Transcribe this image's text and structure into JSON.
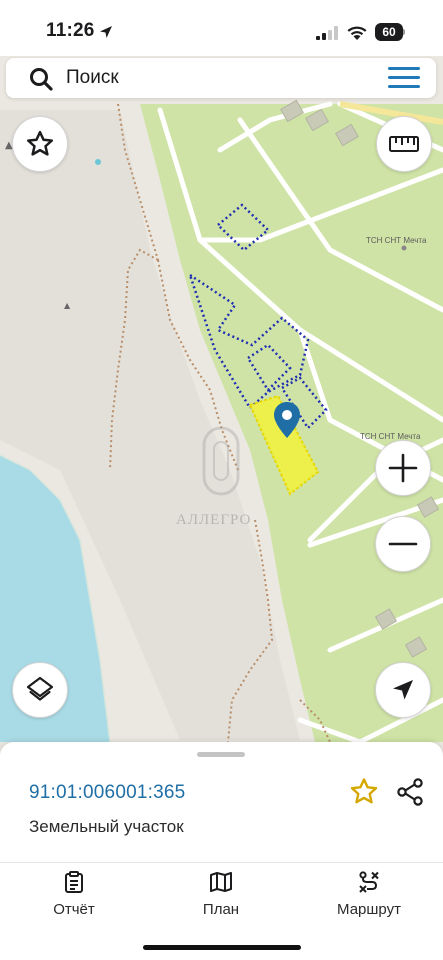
{
  "status_bar": {
    "time": "11:26",
    "battery": "60",
    "icons": [
      "location-arrow-icon",
      "signal-icon",
      "wifi-icon",
      "battery-icon"
    ]
  },
  "search": {
    "placeholder": "Поиск",
    "icon": "search-icon",
    "menu_icon": "hamburger-menu-icon"
  },
  "map": {
    "labels": [
      "ТСН СНТ Мечта",
      "ТСН СНТ Мечта"
    ],
    "watermark": "АЛЛЕГРО",
    "colors": {
      "land": "#cfe3a6",
      "terrain": "#eeebe4",
      "water": "#a9dbe6",
      "parcel_border": "#1f2fb3",
      "selected_parcel": "#f2f23a",
      "marker": "#1f6fa6"
    },
    "controls": [
      "favorites-star-icon",
      "ruler-icon",
      "zoom-in-icon",
      "zoom-out-icon",
      "layers-icon",
      "navigation-arrow-icon"
    ]
  },
  "sheet": {
    "cadastral_number": "91:01:006001:365",
    "parcel_type": "Земельный участок",
    "favorite_icon": "star-icon",
    "share_icon": "share-icon"
  },
  "tabs": [
    {
      "label": "Отчёт",
      "icon": "report-clipboard-icon"
    },
    {
      "label": "План",
      "icon": "map-plan-icon"
    },
    {
      "label": "Маршрут",
      "icon": "route-icon"
    }
  ]
}
